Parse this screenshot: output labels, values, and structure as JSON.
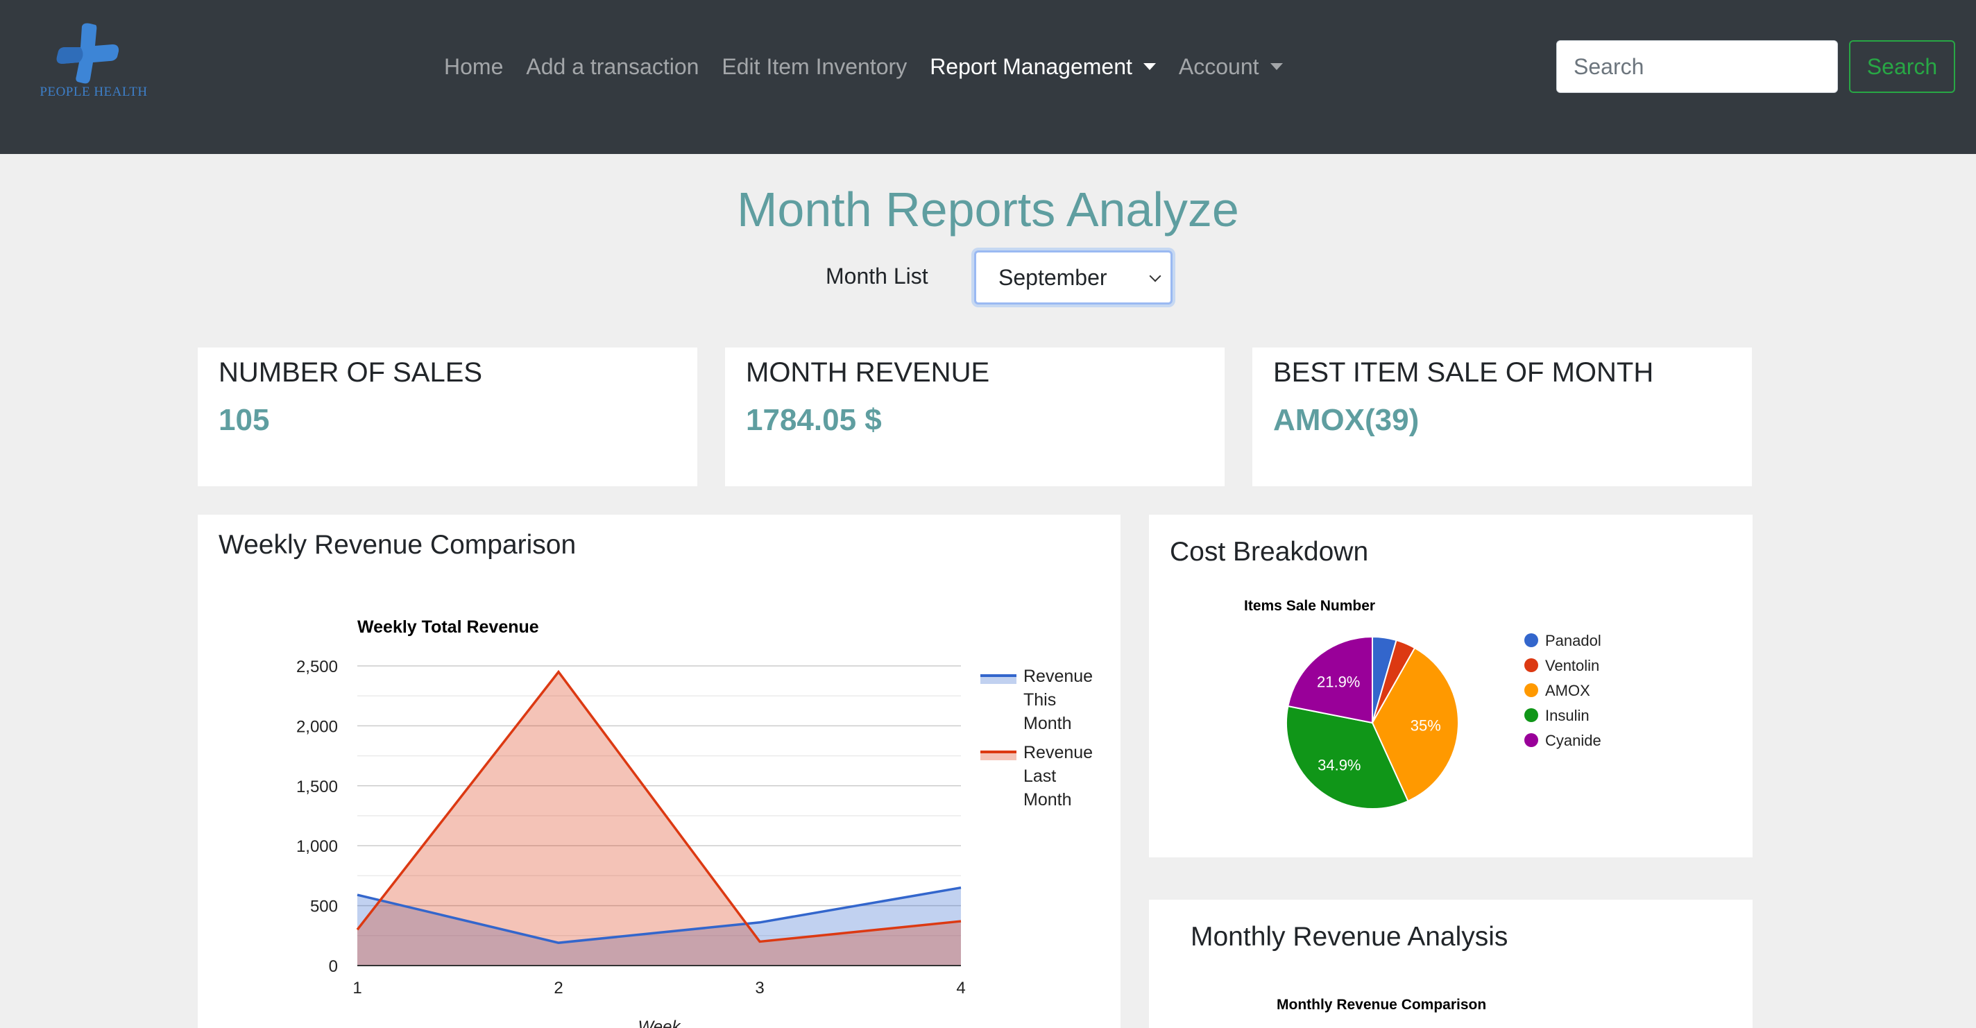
{
  "brand": {
    "logo_text": "PEOPLE HEALTH",
    "logo_icon": "medical-cross-icon"
  },
  "nav": {
    "items": [
      {
        "label": "Home",
        "dropdown": false,
        "active": false
      },
      {
        "label": "Add a transaction",
        "dropdown": false,
        "active": false
      },
      {
        "label": "Edit Item Inventory",
        "dropdown": false,
        "active": false
      },
      {
        "label": "Report Management",
        "dropdown": true,
        "active": true
      },
      {
        "label": "Account",
        "dropdown": true,
        "active": false
      }
    ],
    "search_placeholder": "Search",
    "search_button": "Search"
  },
  "page": {
    "title": "Month Reports Analyze",
    "month_label": "Month List",
    "month_selected": "September"
  },
  "stats": [
    {
      "title": "NUMBER OF SALES",
      "value": "105"
    },
    {
      "title": "MONTH REVENUE",
      "value": "1784.05 $"
    },
    {
      "title": "BEST ITEM SALE OF MONTH",
      "value": "AMOX(39)"
    }
  ],
  "weekly_card": {
    "heading": "Weekly Revenue Comparison"
  },
  "cost_card": {
    "heading": "Cost Breakdown"
  },
  "monthly_card": {
    "heading": "Monthly Revenue Analysis",
    "chart_title": "Monthly Revenue Comparison"
  },
  "colors": {
    "accent": "#5f9ea0",
    "navbar": "#343a40",
    "revenue_this_month": "#3366cc",
    "revenue_last_month": "#dc3912",
    "panadol": "#3366cc",
    "ventolin": "#dc3912",
    "amox": "#ff9900",
    "insulin": "#109618",
    "cyanide": "#990099"
  },
  "chart_data": [
    {
      "type": "area",
      "title": "Weekly Total Revenue",
      "xlabel": "Week",
      "ylabel": "",
      "x": [
        1,
        2,
        3,
        4
      ],
      "ylim": [
        0,
        2500
      ],
      "yticks": [
        0,
        500,
        1000,
        1500,
        2000,
        2500
      ],
      "ytick_labels": [
        "0",
        "500",
        "1,000",
        "1,500",
        "2,000",
        "2,500"
      ],
      "grid": true,
      "legend": "right",
      "series": [
        {
          "name": "Revenue This Month",
          "values": [
            590,
            190,
            360,
            650
          ]
        },
        {
          "name": "Revenue Last Month",
          "values": [
            300,
            2450,
            200,
            370
          ]
        }
      ]
    },
    {
      "type": "pie",
      "title": "Items Sale Number",
      "legend": "right",
      "categories": [
        "Panadol",
        "Ventolin",
        "AMOX",
        "Insulin",
        "Cyanide"
      ],
      "values": [
        4.5,
        3.7,
        35,
        34.9,
        21.9
      ],
      "slice_labels": [
        "",
        "",
        "35%",
        "34.9%",
        "21.9%"
      ]
    }
  ]
}
